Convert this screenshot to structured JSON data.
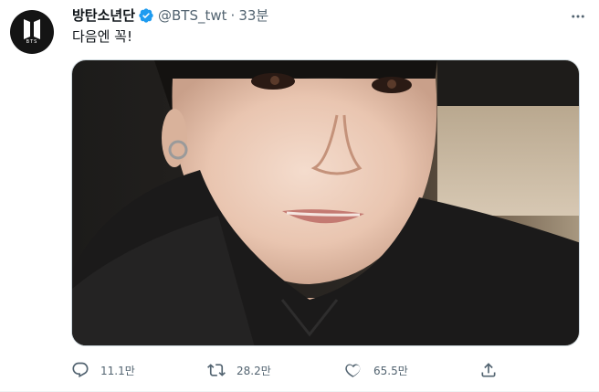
{
  "tweet": {
    "display_name": "방탄소년단",
    "handle": "@BTS_twt",
    "separator": "·",
    "time": "33분",
    "text": "다음엔 꼭!",
    "avatar": {
      "logo_text": "BTS",
      "background": "#141414"
    },
    "verified_color": "#1d9bf0",
    "media": {
      "image": "selfie-photo"
    },
    "actions": {
      "reply_count": "11.1만",
      "retweet_count": "28.2만",
      "like_count": "65.5만"
    }
  },
  "icons": {
    "more": "more-horizontal-icon",
    "reply": "reply-icon",
    "retweet": "retweet-icon",
    "like": "heart-icon",
    "share": "share-icon",
    "verified": "verified-badge-icon"
  },
  "colors": {
    "text_primary": "#0f1419",
    "text_secondary": "#536471",
    "border": "#cfd9de"
  }
}
